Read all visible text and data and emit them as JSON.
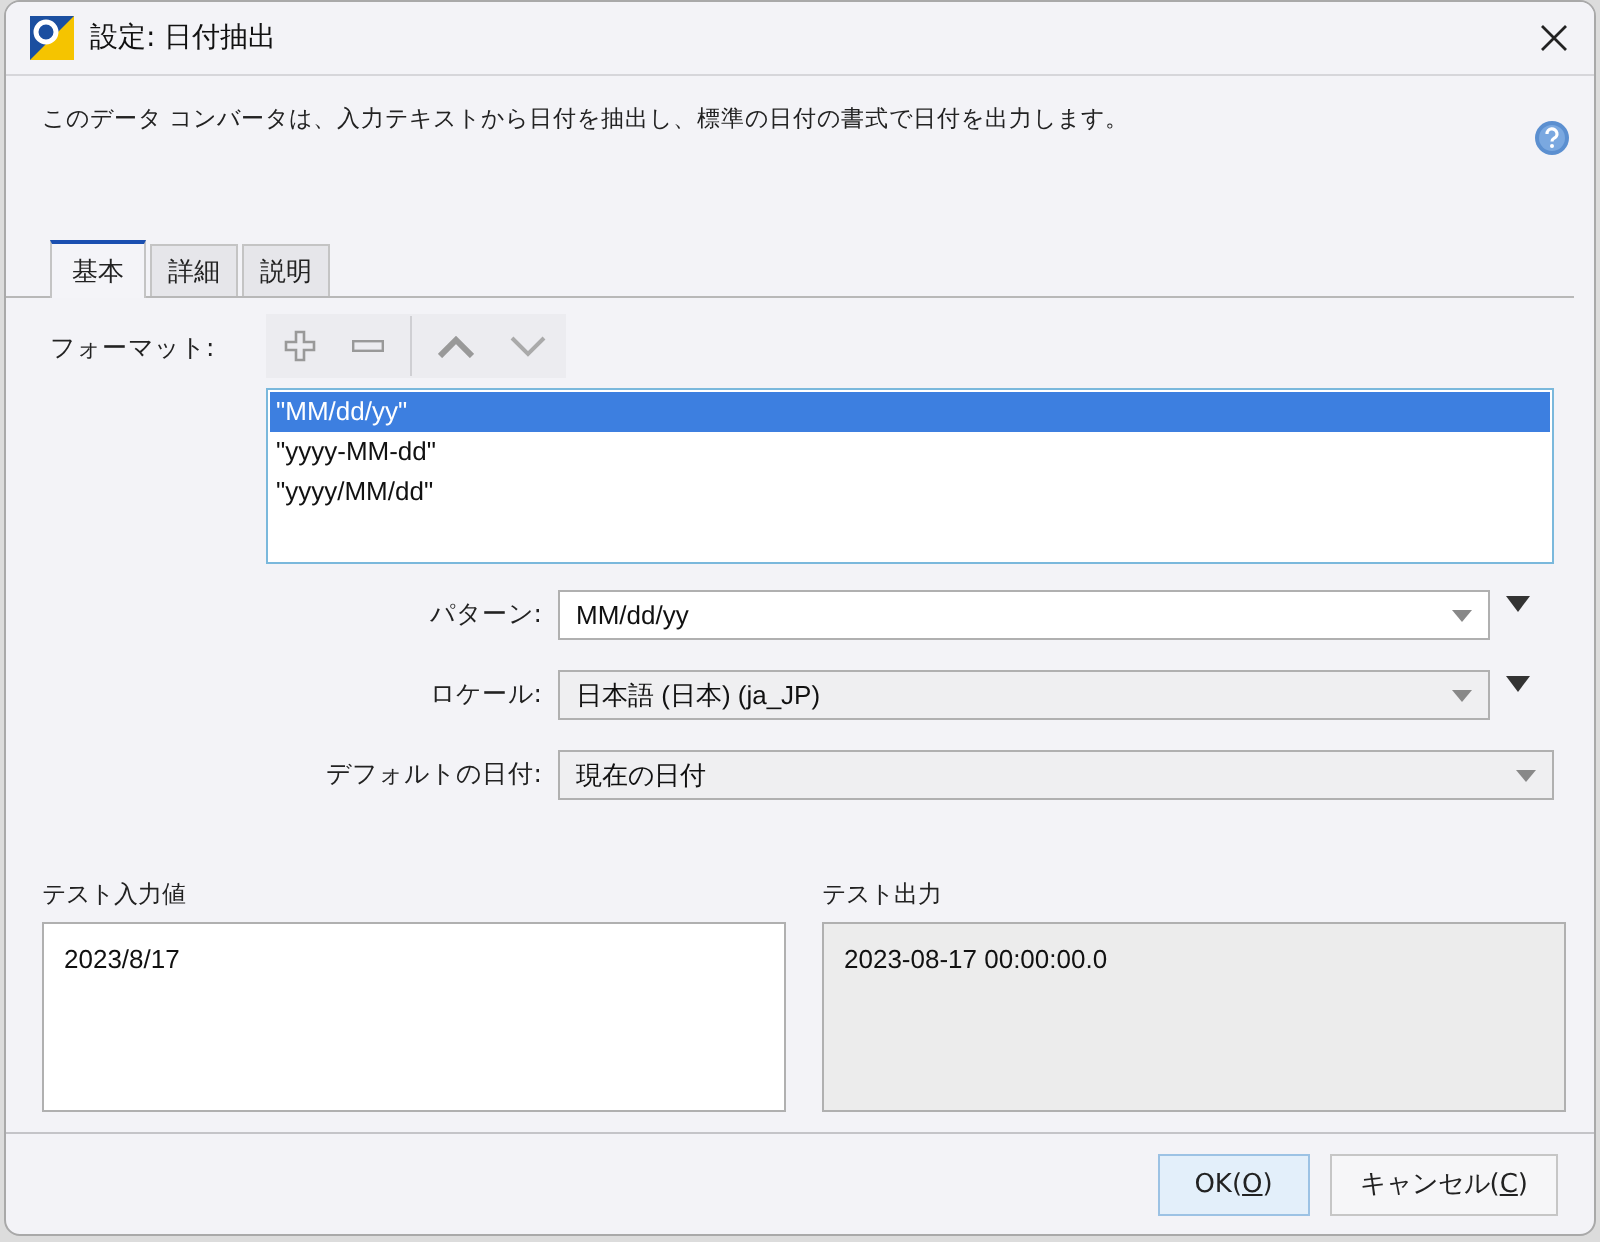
{
  "window": {
    "title": "設定: 日付抽出"
  },
  "description": "このデータ コンバータは、入力テキストから日付を抽出し、標準の日付の書式で日付を出力します。",
  "tabs": [
    {
      "label": "基本",
      "selected": true
    },
    {
      "label": "詳細",
      "selected": false
    },
    {
      "label": "説明",
      "selected": false
    }
  ],
  "format": {
    "label": "フォーマット:",
    "items": [
      {
        "text": "\"MM/dd/yy\"",
        "selected": true
      },
      {
        "text": "\"yyyy-MM-dd\"",
        "selected": false
      },
      {
        "text": "\"yyyy/MM/dd\"",
        "selected": false
      }
    ]
  },
  "fields": [
    {
      "label": "パターン:",
      "value": "MM/dd/yy",
      "kind": "editable",
      "menu_button": true
    },
    {
      "label": "ロケール:",
      "value": "日本語 (日本) (ja_JP)",
      "kind": "dropdown",
      "menu_button": true
    },
    {
      "label": "デフォルトの日付:",
      "value": "現在の日付",
      "kind": "dropdown",
      "menu_button": false
    }
  ],
  "test_input": {
    "label": "テスト入力値",
    "value": "2023/8/17"
  },
  "test_output": {
    "label": "テスト出力",
    "value": "2023-08-17 00:00:00.0"
  },
  "buttons": [
    {
      "prefix": "OK(",
      "key": "O",
      "suffix": ")",
      "default": true
    },
    {
      "prefix": "キャンセル(",
      "key": "C",
      "suffix": ")",
      "default": false
    }
  ]
}
